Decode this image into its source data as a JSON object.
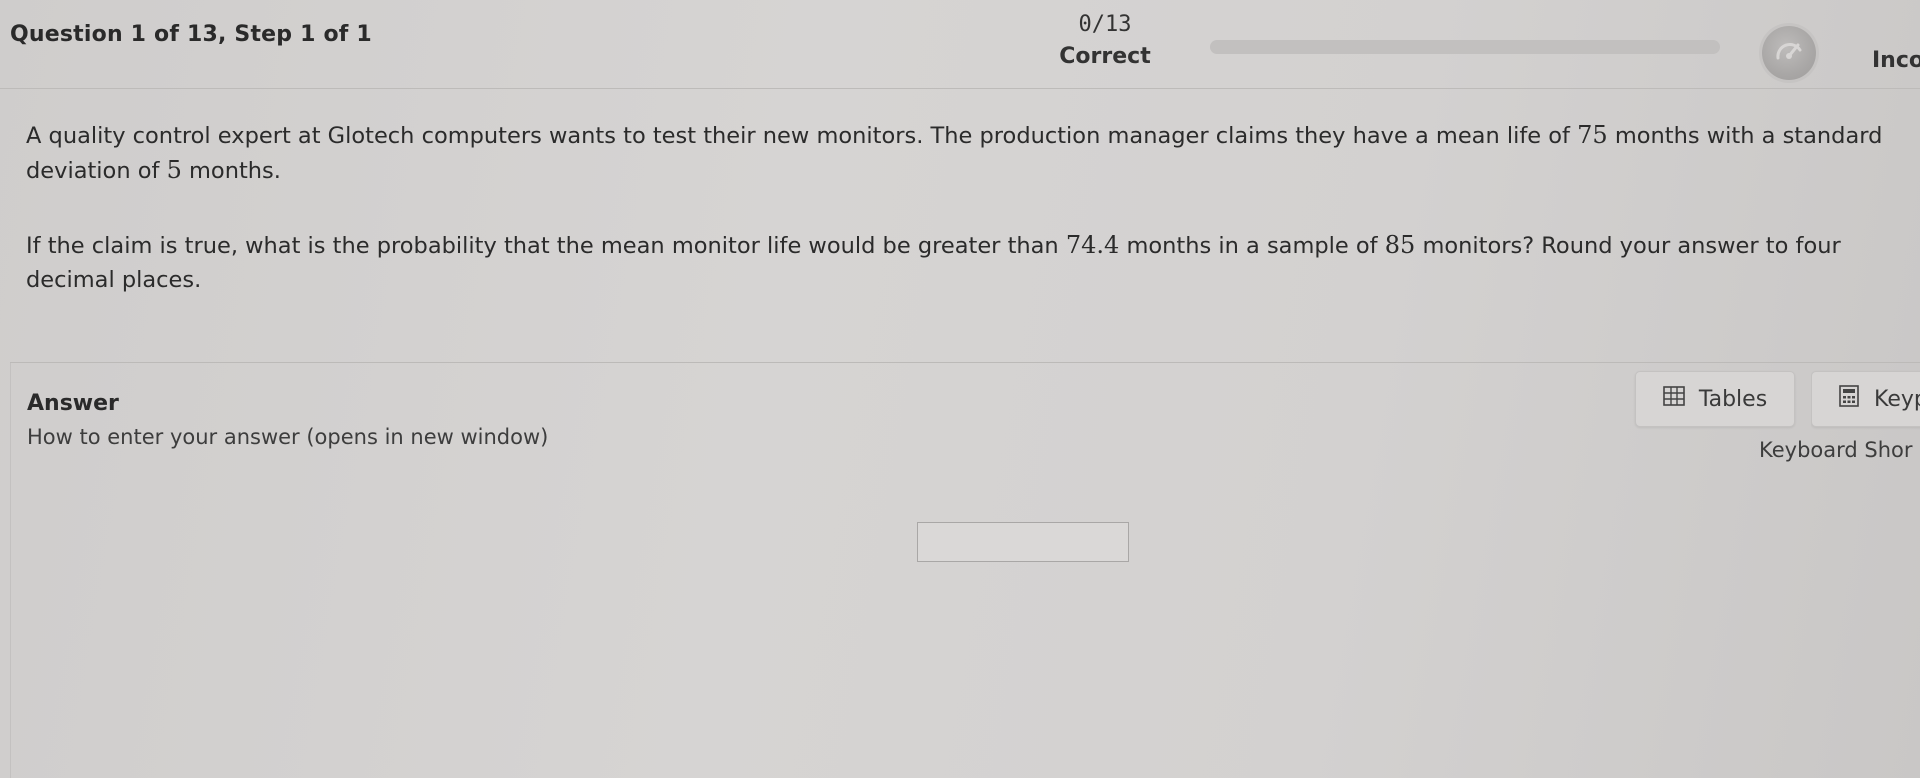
{
  "header": {
    "question_label": "Question 1 of 13,  Step 1 of 1",
    "score_count": "0/13",
    "correct_label": "Correct",
    "incorrect_label": "Inco",
    "progress_fraction": 0,
    "progress_color": "#6b9b3a"
  },
  "question": {
    "p1_a": "A quality control expert at Glotech computers wants to test their new monitors.  The production manager claims they have a mean life of ",
    "p1_mean": "75",
    "p1_b": " months with a standard deviation of ",
    "p1_sd": "5",
    "p1_c": " months.",
    "p2_a": "If the claim is true, what is the probability that the mean monitor life would be greater than ",
    "p2_value": "74.4",
    "p2_b": " months in a sample of ",
    "p2_n": "85",
    "p2_c": " monitors? Round your answer to four decimal places."
  },
  "answer": {
    "title": "Answer",
    "howto_link": "How to enter your answer (opens in new window)",
    "tables_label": "Tables",
    "tables_icon": "table-grid-icon",
    "keypad_label": "Keyp",
    "keypad_icon": "calculator-icon",
    "shortcuts_link": "Keyboard Shor",
    "input_value": "",
    "input_placeholder": ""
  }
}
